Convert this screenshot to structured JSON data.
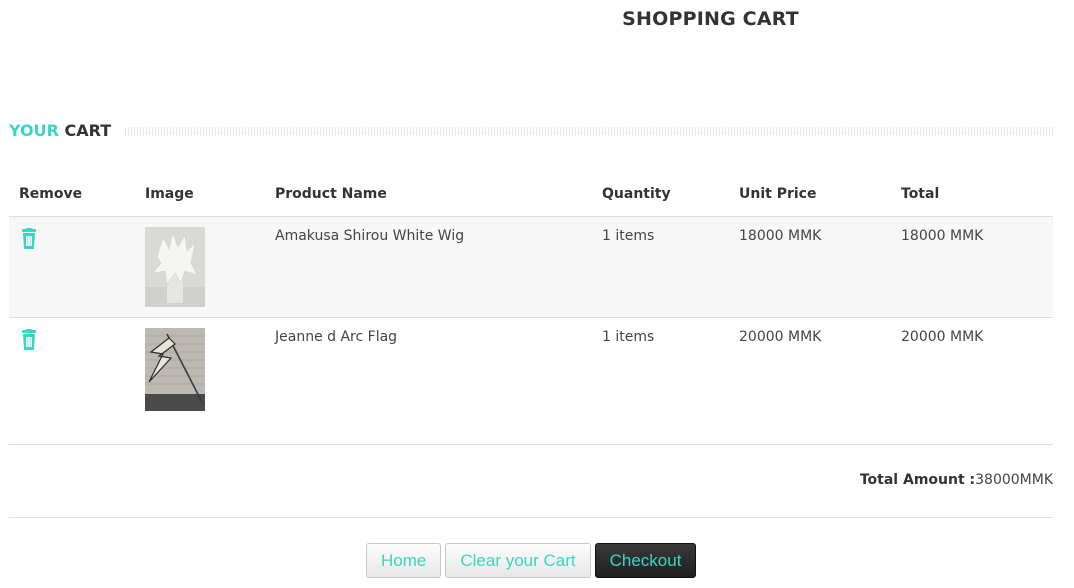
{
  "page": {
    "title": "SHOPPING CART"
  },
  "section": {
    "title_accent": "YOUR",
    "title_rest": "CART"
  },
  "table": {
    "headers": [
      "Remove",
      "Image",
      "Product Name",
      "Quantity",
      "Unit Price",
      "Total"
    ],
    "rows": [
      {
        "remove_icon": "trash-icon",
        "image_alt": "white wig product photo",
        "name": "Amakusa Shirou White Wig",
        "quantity": "1 items",
        "unit_price": "18000 MMK",
        "total": "18000 MMK"
      },
      {
        "remove_icon": "trash-icon",
        "image_alt": "flag product photo",
        "name": "Jeanne d Arc Flag",
        "quantity": "1 items",
        "unit_price": "20000 MMK",
        "total": "20000 MMK"
      }
    ]
  },
  "summary": {
    "label": "Total Amount :",
    "value": "38000MMK"
  },
  "actions": {
    "home": "Home",
    "clear": "Clear your Cart",
    "checkout": "Checkout"
  },
  "colors": {
    "accent": "#3cd4c4",
    "text": "#333333",
    "row_stripe": "#f7f7f7",
    "checkout_bg": "#2a2a2a"
  }
}
